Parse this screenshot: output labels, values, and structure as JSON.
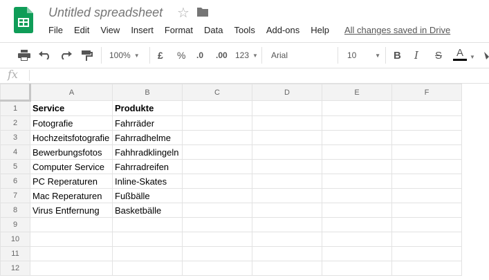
{
  "app": {
    "title": "Untitled spreadsheet",
    "star_icon": "star-icon",
    "folder_icon": "folder-icon",
    "save_status": "All changes saved in Drive"
  },
  "menu": [
    "File",
    "Edit",
    "View",
    "Insert",
    "Format",
    "Data",
    "Tools",
    "Add-ons",
    "Help"
  ],
  "toolbar": {
    "zoom": "100%",
    "currency": "£",
    "percent": "%",
    "decrease_decimals": ".0",
    "increase_decimals": ".00",
    "more_formats": "123",
    "font": "Arial",
    "font_size": "10",
    "bold": "B",
    "italic": "I",
    "strike": "S",
    "text_color": "A"
  },
  "formula_bar": {
    "fx_label": "fx",
    "value": ""
  },
  "columns": [
    "A",
    "B",
    "C",
    "D",
    "E",
    "F"
  ],
  "rows": [
    [
      "Service",
      "Produkte"
    ],
    [
      "Fotografie",
      "Fahrräder"
    ],
    [
      "Hochzeitsfotografie",
      "Fahrradhelme"
    ],
    [
      "Bewerbungsfotos",
      "Fahhradklingeln"
    ],
    [
      "Computer Service",
      "Fahrradreifen"
    ],
    [
      "PC Reperaturen",
      "Inline-Skates"
    ],
    [
      "Mac Reperaturen",
      "Fußbälle"
    ],
    [
      "Virus Entfernung",
      "Basketbälle"
    ],
    [
      "",
      ""
    ],
    [
      "",
      ""
    ],
    [
      "",
      ""
    ],
    [
      "",
      ""
    ]
  ],
  "row_numbers": [
    "1",
    "2",
    "3",
    "4",
    "5",
    "6",
    "7",
    "8",
    "9",
    "10",
    "11",
    "12"
  ],
  "colors": {
    "sheets_green": "#0f9d58",
    "header_bg": "#f3f3f3",
    "grid_line": "#e2e2e2"
  }
}
